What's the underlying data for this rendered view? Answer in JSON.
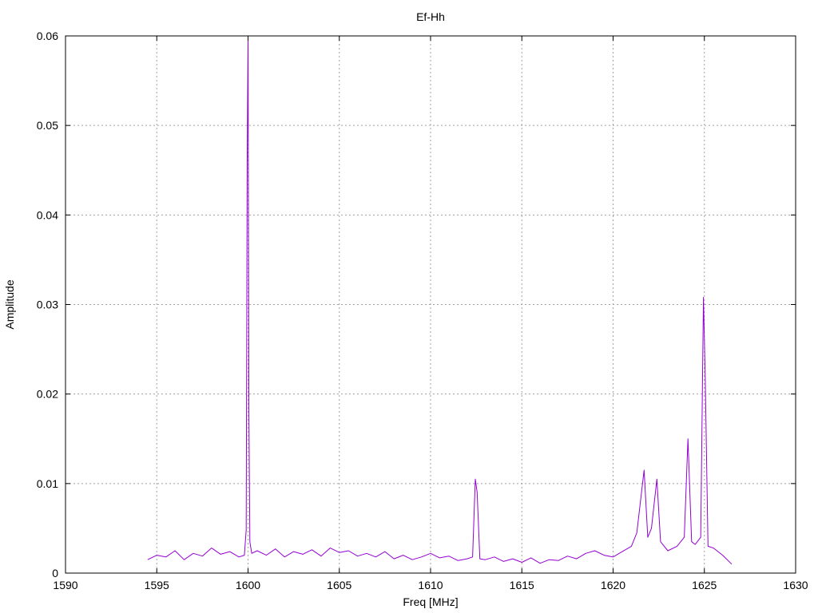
{
  "chart_data": {
    "type": "line",
    "title": "Ef-Hh",
    "xlabel": "Freq [MHz]",
    "ylabel": "Amplitude",
    "xlim": [
      1590,
      1630
    ],
    "ylim": [
      0,
      0.06
    ],
    "xticks": [
      1590,
      1595,
      1600,
      1605,
      1610,
      1615,
      1620,
      1625,
      1630
    ],
    "yticks": [
      0,
      0.01,
      0.02,
      0.03,
      0.04,
      0.05,
      0.06
    ],
    "xtick_labels": [
      "1590",
      "1595",
      "1600",
      "1605",
      "1610",
      "1615",
      "1620",
      "1625",
      "1630"
    ],
    "ytick_labels": [
      "0",
      "0.01",
      "0.02",
      "0.03",
      "0.04",
      "0.05",
      "0.06"
    ],
    "grid": true,
    "legend": "none",
    "series": [
      {
        "color": "#9400d3",
        "x": [
          1594.5,
          1595,
          1595.5,
          1596,
          1596.5,
          1597,
          1597.5,
          1598,
          1598.5,
          1599,
          1599.5,
          1599.8,
          1599.9,
          1599.95,
          1600.0,
          1600.05,
          1600.1,
          1600.2,
          1600.5,
          1601,
          1601.5,
          1602,
          1602.5,
          1603,
          1603.5,
          1604,
          1604.5,
          1605,
          1605.5,
          1606,
          1606.5,
          1607,
          1607.5,
          1608,
          1608.5,
          1609,
          1609.5,
          1610,
          1610.5,
          1611,
          1611.5,
          1612,
          1612.3,
          1612.45,
          1612.55,
          1612.7,
          1613,
          1613.5,
          1614,
          1614.5,
          1615,
          1615.5,
          1616,
          1616.5,
          1617,
          1617.5,
          1618,
          1618.5,
          1619,
          1619.5,
          1620,
          1620.5,
          1621,
          1621.3,
          1621.7,
          1621.9,
          1622.1,
          1622.4,
          1622.6,
          1623,
          1623.5,
          1623.9,
          1624.1,
          1624.3,
          1624.5,
          1624.8,
          1624.95,
          1625.05,
          1625.2,
          1625.5,
          1626,
          1626.5
        ],
        "y": [
          0.0015,
          0.002,
          0.0018,
          0.0025,
          0.0015,
          0.0022,
          0.0019,
          0.0028,
          0.0021,
          0.0024,
          0.0018,
          0.002,
          0.0048,
          0.0455,
          0.06,
          0.018,
          0.0035,
          0.0022,
          0.0025,
          0.002,
          0.0027,
          0.0018,
          0.0024,
          0.0021,
          0.0026,
          0.0019,
          0.0028,
          0.0023,
          0.0025,
          0.0019,
          0.0022,
          0.0018,
          0.0024,
          0.0016,
          0.002,
          0.0015,
          0.0018,
          0.0022,
          0.0017,
          0.0019,
          0.0014,
          0.0016,
          0.0018,
          0.0105,
          0.009,
          0.0016,
          0.0015,
          0.0018,
          0.0013,
          0.0016,
          0.0012,
          0.0017,
          0.0011,
          0.0015,
          0.0014,
          0.0019,
          0.0016,
          0.0022,
          0.0025,
          0.002,
          0.0018,
          0.0024,
          0.003,
          0.0045,
          0.0115,
          0.004,
          0.005,
          0.0105,
          0.0035,
          0.0025,
          0.003,
          0.004,
          0.015,
          0.0035,
          0.0032,
          0.004,
          0.0308,
          0.0215,
          0.003,
          0.0028,
          0.002,
          0.001
        ]
      }
    ]
  }
}
